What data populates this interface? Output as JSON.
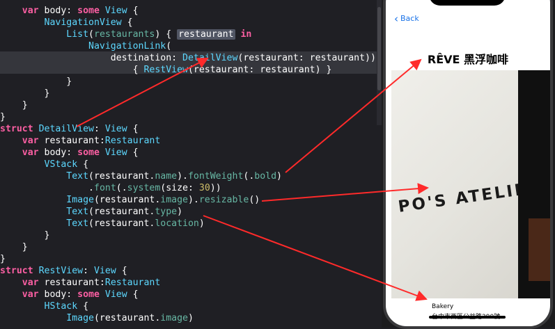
{
  "colors": {
    "editor_bg": "#1f1f24",
    "keyword": "#fc5fa3",
    "type": "#5dd8ff",
    "property": "#67b7a4",
    "number": "#d0bf69",
    "arrow": "#ff2a2a",
    "link": "#1a73e8"
  },
  "code": [
    {
      "indent": "    ",
      "tokens": [
        {
          "t": "var",
          "c": "k"
        },
        {
          "t": " body: "
        },
        {
          "t": "some",
          "c": "k"
        },
        {
          "t": " "
        },
        {
          "t": "View",
          "c": "t"
        },
        {
          "t": " {"
        }
      ]
    },
    {
      "indent": "        ",
      "tokens": [
        {
          "t": "NavigationView",
          "c": "t"
        },
        {
          "t": " {"
        }
      ]
    },
    {
      "indent": "            ",
      "tokens": [
        {
          "t": "List",
          "c": "t"
        },
        {
          "t": "("
        },
        {
          "t": "restaurants",
          "c": "p"
        },
        {
          "t": ") { "
        },
        {
          "t": "restaurant",
          "c": "sel"
        },
        {
          "t": " "
        },
        {
          "t": "in",
          "c": "k"
        }
      ]
    },
    {
      "indent": "                ",
      "tokens": [
        {
          "t": "NavigationLink",
          "c": "t"
        },
        {
          "t": "("
        }
      ]
    },
    {
      "indent": "                    ",
      "tokens": [
        {
          "t": "destination: "
        },
        {
          "t": "DetailView",
          "c": "t"
        },
        {
          "t": "(restaurant: restaurant))"
        }
      ]
    },
    {
      "indent": "                        ",
      "tokens": [
        {
          "t": "{ "
        },
        {
          "t": "RestView",
          "c": "t"
        },
        {
          "t": "(restaurant: restaurant) }"
        }
      ]
    },
    {
      "indent": "            ",
      "tokens": [
        {
          "t": "}"
        }
      ]
    },
    {
      "indent": "        ",
      "tokens": [
        {
          "t": "}"
        }
      ]
    },
    {
      "indent": "    ",
      "tokens": [
        {
          "t": "}"
        }
      ]
    },
    {
      "indent": "",
      "tokens": [
        {
          "t": "}"
        }
      ]
    },
    {
      "indent": "",
      "tokens": [
        {
          "t": "struct",
          "c": "k"
        },
        {
          "t": " "
        },
        {
          "t": "DetailView",
          "c": "t"
        },
        {
          "t": ": "
        },
        {
          "t": "View",
          "c": "t"
        },
        {
          "t": " {"
        }
      ]
    },
    {
      "indent": "    ",
      "tokens": [
        {
          "t": "var",
          "c": "k"
        },
        {
          "t": " restaurant:"
        },
        {
          "t": "Restaurant",
          "c": "t"
        }
      ]
    },
    {
      "indent": "    ",
      "tokens": [
        {
          "t": "var",
          "c": "k"
        },
        {
          "t": " body: "
        },
        {
          "t": "some",
          "c": "k"
        },
        {
          "t": " "
        },
        {
          "t": "View",
          "c": "t"
        },
        {
          "t": " {"
        }
      ]
    },
    {
      "indent": "        ",
      "tokens": [
        {
          "t": "VStack",
          "c": "t"
        },
        {
          "t": " {"
        }
      ]
    },
    {
      "indent": "            ",
      "tokens": [
        {
          "t": "Text",
          "c": "t"
        },
        {
          "t": "(restaurant."
        },
        {
          "t": "name",
          "c": "p"
        },
        {
          "t": ")."
        },
        {
          "t": "fontWeight",
          "c": "p"
        },
        {
          "t": "(."
        },
        {
          "t": "bold",
          "c": "p"
        },
        {
          "t": ")"
        }
      ]
    },
    {
      "indent": "                ",
      "tokens": [
        {
          "t": "."
        },
        {
          "t": "font",
          "c": "p"
        },
        {
          "t": "(."
        },
        {
          "t": "system",
          "c": "p"
        },
        {
          "t": "(size: "
        },
        {
          "t": "30",
          "c": "n"
        },
        {
          "t": "))"
        }
      ]
    },
    {
      "indent": "            ",
      "tokens": [
        {
          "t": "Image",
          "c": "t"
        },
        {
          "t": "(restaurant."
        },
        {
          "t": "image",
          "c": "p"
        },
        {
          "t": ")."
        },
        {
          "t": "resizable",
          "c": "p"
        },
        {
          "t": "()"
        }
      ]
    },
    {
      "indent": "            ",
      "tokens": [
        {
          "t": "Text",
          "c": "t"
        },
        {
          "t": "(restaurant."
        },
        {
          "t": "type",
          "c": "p"
        },
        {
          "t": ")"
        }
      ]
    },
    {
      "indent": "            ",
      "tokens": [
        {
          "t": "Text",
          "c": "t"
        },
        {
          "t": "(restaurant."
        },
        {
          "t": "location",
          "c": "p"
        },
        {
          "t": ")"
        }
      ]
    },
    {
      "indent": "        ",
      "tokens": [
        {
          "t": "}"
        }
      ]
    },
    {
      "indent": "    ",
      "tokens": [
        {
          "t": "}"
        }
      ]
    },
    {
      "indent": "",
      "tokens": [
        {
          "t": "}"
        }
      ]
    },
    {
      "indent": "",
      "tokens": [
        {
          "t": "struct",
          "c": "k"
        },
        {
          "t": " "
        },
        {
          "t": "RestView",
          "c": "t"
        },
        {
          "t": ": "
        },
        {
          "t": "View",
          "c": "t"
        },
        {
          "t": " {"
        }
      ]
    },
    {
      "indent": "    ",
      "tokens": [
        {
          "t": "var",
          "c": "k"
        },
        {
          "t": " restaurant:"
        },
        {
          "t": "Restaurant",
          "c": "t"
        }
      ]
    },
    {
      "indent": "    ",
      "tokens": [
        {
          "t": "var",
          "c": "k"
        },
        {
          "t": " body: "
        },
        {
          "t": "some",
          "c": "k"
        },
        {
          "t": " "
        },
        {
          "t": "View",
          "c": "t"
        },
        {
          "t": " {"
        }
      ]
    },
    {
      "indent": "        ",
      "tokens": [
        {
          "t": "HStack",
          "c": "t"
        },
        {
          "t": " {"
        }
      ]
    },
    {
      "indent": "            ",
      "tokens": [
        {
          "t": "Image",
          "c": "t"
        },
        {
          "t": "(restaurant."
        },
        {
          "t": "image",
          "c": "p"
        },
        {
          "t": ")"
        }
      ]
    }
  ],
  "phone": {
    "back_label": "Back",
    "back_icon": "chevron-left-icon",
    "title": "RÊVE 黑浮咖啡",
    "sign_text": "PO'S ATELIER",
    "type": "Bakery",
    "location": "台中市西區公益路290號"
  }
}
